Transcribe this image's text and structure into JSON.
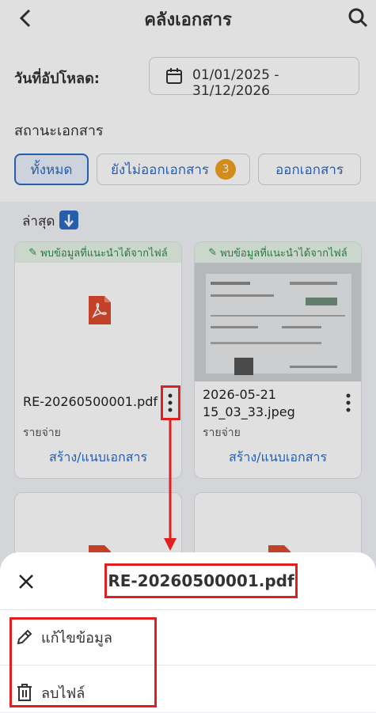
{
  "header": {
    "title": "คลังเอกสาร"
  },
  "filters": {
    "upload_date_label": "วันที่อัปโหลด:",
    "date_range": "01/01/2025 - 31/12/2026",
    "status_label": "สถานะเอกสาร",
    "chips": {
      "all": "ทั้งหมด",
      "pending": "ยังไม่ออกเอกสาร",
      "pending_count": "3",
      "issued": "ออกเอกสาร"
    }
  },
  "list": {
    "sort_label": "ล่าสุด",
    "cards": [
      {
        "suggest": "พบข้อมูลที่แนะนำได้จากไฟล์",
        "filename": "RE-20260500001.pdf",
        "category": "รายจ่าย",
        "action": "สร้าง/แนบเอกสาร"
      },
      {
        "suggest": "พบข้อมูลที่แนะนำได้จากไฟล์",
        "filename": "2026-05-21 15_03_33.jpeg",
        "category": "รายจ่าย",
        "action": "สร้าง/แนบเอกสาร"
      }
    ]
  },
  "sheet": {
    "title": "RE-20260500001.pdf",
    "items": {
      "edit": "แก้ไขข้อมูล",
      "delete": "ลบไฟล์"
    }
  },
  "colors": {
    "accent": "#2d6bc4",
    "highlight": "#e02020",
    "badge": "#f0a020",
    "suggest_text": "#2e8b4a"
  }
}
